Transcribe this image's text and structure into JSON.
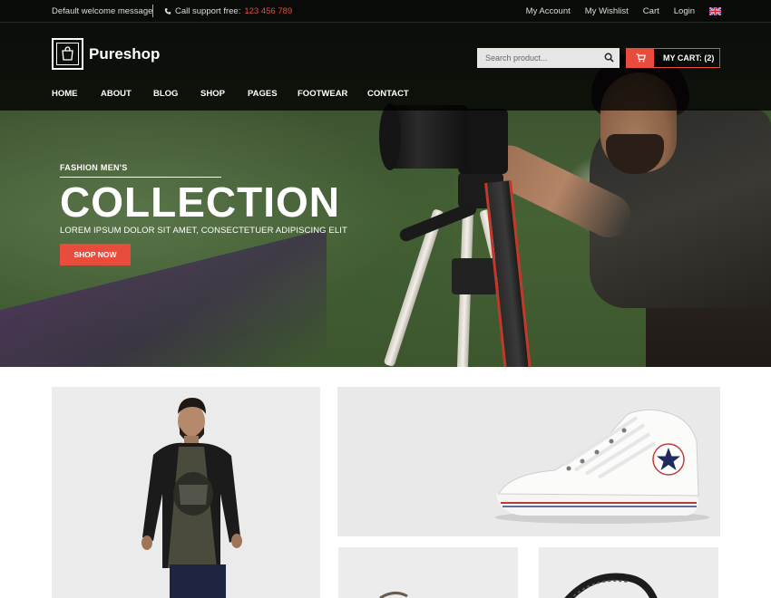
{
  "topbar": {
    "welcome": "Default welcome message",
    "support_label": "Call support free:",
    "phone": "123 456 789",
    "links": [
      "My Account",
      "My Wishlist",
      "Cart",
      "Login"
    ],
    "flag_icon": "uk-flag-icon"
  },
  "header": {
    "logo": "Pureshop",
    "search_placeholder": "Search product...",
    "cart_label": "MY CART: (2)",
    "nav": [
      "HOME",
      "ABOUT",
      "BLOG",
      "SHOP",
      "PAGES",
      "FOOTWEAR",
      "CONTACT"
    ]
  },
  "hero": {
    "subtitle": "FASHION MEN'S",
    "title": "COLLECTION",
    "description": "LOREM IPSUM DOLOR SIT AMET, CONSECTETUER ADIPISCING ELIT",
    "button": "SHOP NOW"
  },
  "products": [
    "man-jacket-image",
    "white-sneaker-image",
    "product-image-3",
    "product-image-4"
  ],
  "colors": {
    "accent": "#e84c3d",
    "header_bg": "#1c1c1c"
  }
}
